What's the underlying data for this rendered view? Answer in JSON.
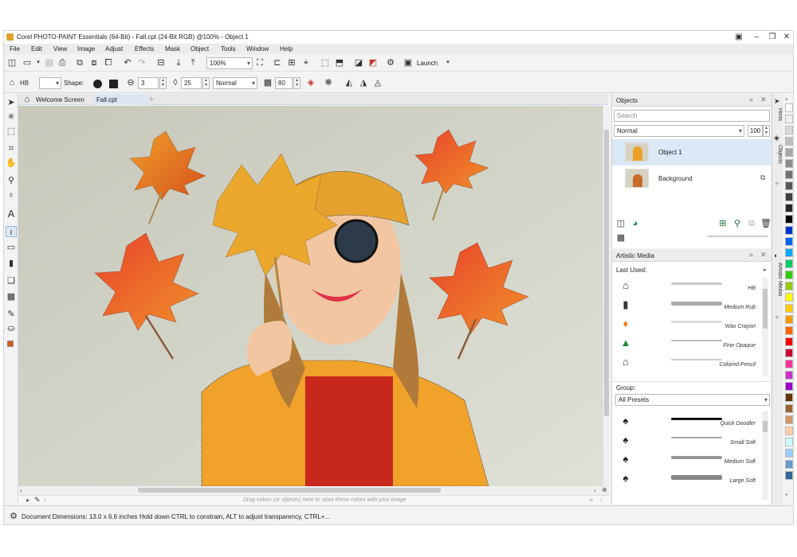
{
  "window": {
    "title": "Corel PHOTO-PAINT Essentials (64-Bit) - Fall.cpt (24-Bit RGB) @100% - Object 1"
  },
  "menu": [
    "File",
    "Edit",
    "View",
    "Image",
    "Adjust",
    "Effects",
    "Mask",
    "Object",
    "Tools",
    "Window",
    "Help"
  ],
  "toolbar": {
    "zoom": "100%",
    "launch_label": "Launch"
  },
  "property_bar": {
    "brush": "HB",
    "shape_label": "Shape:",
    "size": "3",
    "transparency": "25",
    "merge_mode": "Normal",
    "opacity": "80"
  },
  "doc_tabs": {
    "welcome": "Welcome Screen",
    "file": "Fall.cpt"
  },
  "canvas": {
    "color_well_hint": "Drag colors (or objects) here to store these colors with your image"
  },
  "status": {
    "dimensions": "Document Dimensions: 13.0 x 6.6 inches",
    "hint": "Hold down CTRL to constrain, ALT to adjust transparency, CTRL+..."
  },
  "objects_panel": {
    "title": "Objects",
    "search_placeholder": "Search",
    "merge_mode": "Normal",
    "opacity": "100",
    "objects": [
      {
        "name": "Object 1"
      },
      {
        "name": "Background"
      }
    ]
  },
  "artistic_media_panel": {
    "title": "Artistic Media",
    "last_used_label": "Last Used:",
    "last_used": [
      {
        "name": "HB",
        "icon": "pencil-icon",
        "color": "#333333"
      },
      {
        "name": "Medium Rub",
        "icon": "eraser-icon",
        "color": "#333333"
      },
      {
        "name": "Wax Crayon",
        "icon": "crayon-icon",
        "color": "#e8791c"
      },
      {
        "name": "Fine Opaque",
        "icon": "marker-icon",
        "color": "#1f8a3a"
      },
      {
        "name": "Colored Pencil",
        "icon": "pencil-icon",
        "color": "#333333"
      }
    ],
    "group_label": "Group:",
    "group_value": "All Presets",
    "presets": [
      {
        "name": "Quick Doodler"
      },
      {
        "name": "Small Soft"
      },
      {
        "name": "Medium Soft"
      },
      {
        "name": "Large Soft"
      }
    ]
  },
  "side_tabs": {
    "hints": "Hints",
    "objects": "Objects",
    "artistic_media": "Artistic Media"
  },
  "palette_colors": [
    "#ffffff",
    "#f0f0f0",
    "#d9d9d9",
    "#bfbfbf",
    "#a6a6a6",
    "#8c8c8c",
    "#737373",
    "#595959",
    "#404040",
    "#262626",
    "#000000",
    "#0033cc",
    "#0066ff",
    "#00aaff",
    "#00cc66",
    "#33cc00",
    "#99cc00",
    "#ffff00",
    "#ffcc00",
    "#ff9900",
    "#ff6600",
    "#ff0000",
    "#cc0033",
    "#ff3399",
    "#cc33cc",
    "#9900cc",
    "#663300",
    "#996633",
    "#cc9966",
    "#ffccaa",
    "#ccffff",
    "#99ccff",
    "#6699cc",
    "#336699"
  ]
}
